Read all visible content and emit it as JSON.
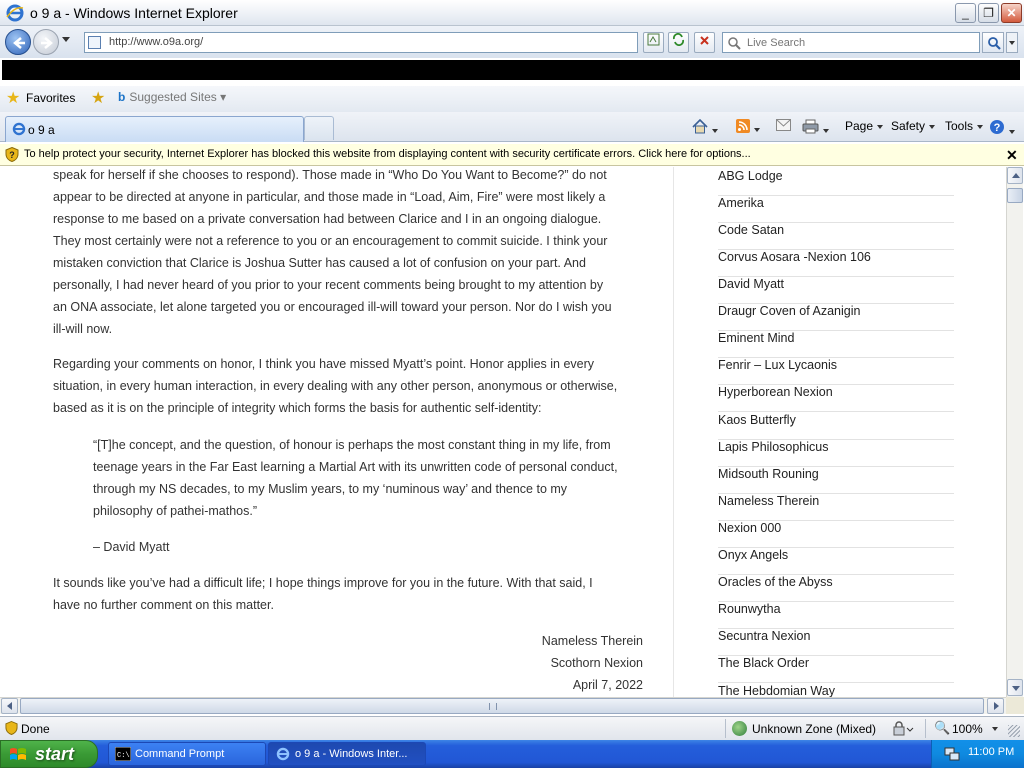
{
  "window": {
    "title": "o 9 a - Windows Internet Explorer"
  },
  "toolbar": {
    "address": "http://www.o9a.org/",
    "search_placeholder": "Live Search"
  },
  "favorites": {
    "label": "Favorites",
    "suggested": "Suggested Sites"
  },
  "tab": {
    "title": "o 9 a"
  },
  "commands": {
    "page": "Page",
    "safety": "Safety",
    "tools": "Tools"
  },
  "infobar": {
    "text": "To help protect your security, Internet Explorer has blocked this website from displaying content with security certificate errors. Click here for options..."
  },
  "article": {
    "p0_lines": [
      "speak for herself if she chooses to respond). Those made in “Who Do You Want to Become?” do not",
      "appear to be directed at anyone in particular, and those made in “Load, Aim, Fire” were most likely a",
      "response to me based on a private conversation had between Clarice and I in an ongoing dialogue.",
      "They most certainly were not a reference to you or an encouragement to commit suicide. I think your",
      "mistaken conviction that Clarice is Joshua Sutter has caused a lot of confusion on your part. And",
      "personally, I had never heard of you prior to your recent comments being brought to my attention by",
      "an ONA associate, let alone targeted you or encouraged ill-will toward your person. Nor do I wish you",
      "ill-will now."
    ],
    "p1_lines": [
      "Regarding your comments on honor, I think you have missed Myatt’s point. Honor applies in every",
      "situation, in every human interaction, in every dealing with any other person, anonymous or otherwise,",
      "based as it is on the principle of integrity which forms the basis for authentic self-identity:"
    ],
    "quote_lines": [
      "“[T]he concept, and the question, of honour is perhaps the most constant thing in my life, from",
      "teenage years in the Far East learning a Martial Art with its unwritten code of personal conduct,",
      "through my NS decades, to my Muslim years, to my ‘numinous way’ and thence to my",
      "philosophy of pathei-mathos.”"
    ],
    "quote_attribution": "– David Myatt",
    "p2_lines": [
      "It sounds like you’ve had a difficult life; I hope things improve for you in the future. With that said, I",
      "have no further comment on this matter."
    ],
    "signature": [
      "Nameless Therein",
      "Scothorn Nexion",
      "April 7, 2022"
    ]
  },
  "sidebar": {
    "links": [
      "ABG Lodge",
      "Amerika",
      "Code Satan",
      "Corvus Aosara -Nexion 106",
      "David Myatt",
      "Draugr Coven of Azanigin",
      "Eminent Mind",
      "Fenrir – Lux Lycaonis",
      "Hyperborean Nexion",
      "Kaos Butterfly",
      "Lapis Philosophicus",
      "Midsouth Rouning",
      "Nameless Therein",
      "Nexion 000",
      "Onyx Angels",
      "Oracles of the Abyss",
      "Rounwytha",
      "Secuntra Nexion",
      "The Black Order",
      "The Hebdomian Way"
    ]
  },
  "status": {
    "text": "Done",
    "zone": "Unknown Zone (Mixed)",
    "zoom": "100%"
  },
  "taskbar": {
    "start": "start",
    "tasks": [
      "Command Prompt",
      "o 9 a - Windows Inter..."
    ],
    "clock": "11:00 PM"
  }
}
